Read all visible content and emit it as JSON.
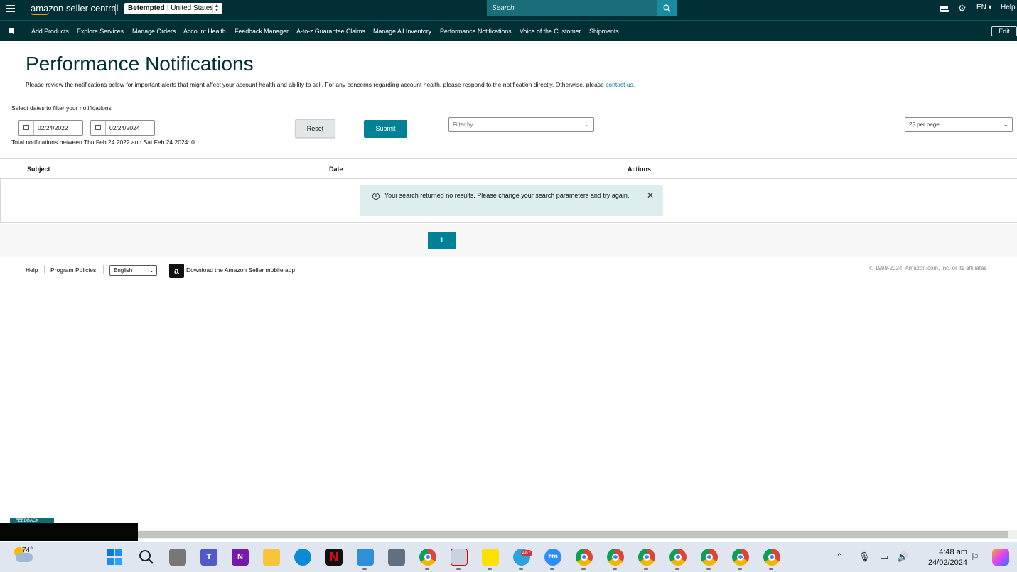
{
  "topbar": {
    "logo": "amazon seller central",
    "store_name": "Betempted",
    "store_region": "United States",
    "search_placeholder": "Search",
    "language": "EN",
    "help": "Help"
  },
  "nav": {
    "items": [
      "Add Products",
      "Explore Services",
      "Manage Orders",
      "Account Health",
      "Feedback Manager",
      "A-to-z Guarantee Claims",
      "Manage All Inventory",
      "Performance Notifications",
      "Voice of the Customer",
      "Shipments"
    ],
    "edit": "Edit"
  },
  "page": {
    "title": "Performance Notifications",
    "intro": "Please review the notifications below for important alerts that might affect your account health and ability to sell. For any concerns regarding account health, please respond to the notification directly. Otherwise, please ",
    "intro_link": "contact us.",
    "filter_label": "Select dates to filter your notifications",
    "start_date": "02/24/2022",
    "end_date": "02/24/2024",
    "total_text": "Total notifications between Thu Feb 24 2022 and Sat Feb 24 2024: 0",
    "reset": "Reset",
    "submit": "Submit",
    "filter_placeholder": "Filter by",
    "per_page": "25 per page"
  },
  "table": {
    "columns": [
      "Subject",
      "Date",
      "Actions"
    ],
    "empty_message": "Your search returned no results. Please change your search parameters and try again."
  },
  "pagination": {
    "current": "1"
  },
  "footer": {
    "help": "Help",
    "policies": "Program Policies",
    "language": "English",
    "app_text": "Download the Amazon Seller mobile app",
    "app_icon_letter": "a",
    "copyright": "© 1999-2024, Amazon.com, Inc. or its affiliates",
    "feedback": "FEEDBACK"
  },
  "taskbar": {
    "temperature": "74°",
    "telegram_badge": "467",
    "zoom_label": "zm",
    "time": "4:48 am",
    "date": "24/02/2024"
  },
  "colors": {
    "header": "#002f36",
    "accent": "#008296",
    "alert_bg": "#dceeee"
  }
}
